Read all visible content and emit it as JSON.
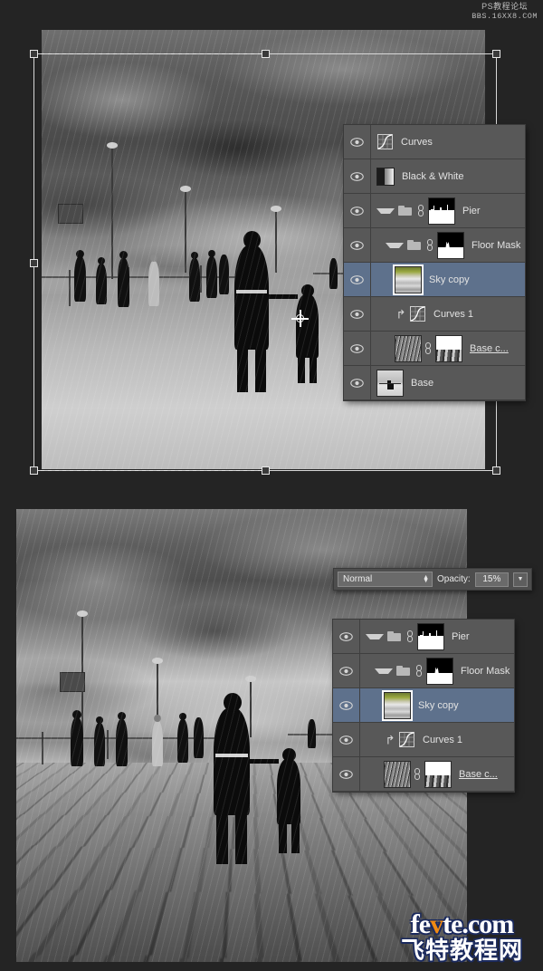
{
  "watermark_top": {
    "line1": "PS教程论坛",
    "line2": "BBS.16XX8.COM"
  },
  "logo": {
    "part1": "fe",
    "accent": "v",
    "part2": "te.com",
    "chinese": "飞特教程网",
    "accent_color": "#f08a12",
    "outline_color": "#1b2a5e"
  },
  "blend_bar": {
    "mode": "Normal",
    "opacity_label": "Opacity:",
    "opacity_value": "15%"
  },
  "layers_panel_top": {
    "rows": [
      {
        "name": "Curves",
        "icon": "curves-adjustment-icon",
        "visible": true,
        "selected": false,
        "indent": 0,
        "clipped": false,
        "group": false,
        "thumb": "none"
      },
      {
        "name": "Black & White",
        "icon": "black-white-adjustment-icon",
        "visible": true,
        "selected": false,
        "indent": 0,
        "clipped": false,
        "group": false,
        "thumb": "none"
      },
      {
        "name": "Pier",
        "icon": "folder-icon",
        "visible": true,
        "selected": false,
        "indent": 0,
        "clipped": false,
        "group": true,
        "thumb": "mask-pier"
      },
      {
        "name": "Floor Mask",
        "icon": "folder-icon",
        "visible": true,
        "selected": false,
        "indent": 1,
        "clipped": false,
        "group": true,
        "thumb": "mask-floor"
      },
      {
        "name": "Sky copy",
        "icon": "layer-thumbnail",
        "visible": true,
        "selected": true,
        "indent": 1,
        "clipped": false,
        "group": false,
        "thumb": "sky"
      },
      {
        "name": "Curves 1",
        "icon": "curves-adjustment-icon",
        "visible": true,
        "selected": false,
        "indent": 1,
        "clipped": true,
        "group": false,
        "thumb": "none"
      },
      {
        "name": "Base c...",
        "icon": "layer-thumbnail",
        "visible": true,
        "selected": false,
        "indent": 1,
        "clipped": false,
        "group": false,
        "thumb": "noise-mask",
        "underline": true
      },
      {
        "name": "Base",
        "icon": "layer-thumbnail",
        "visible": true,
        "selected": false,
        "indent": 0,
        "clipped": false,
        "group": false,
        "thumb": "base"
      }
    ]
  },
  "layers_panel_bottom": {
    "rows": [
      {
        "name": "Pier",
        "icon": "folder-icon",
        "visible": true,
        "selected": false,
        "indent": 0,
        "clipped": false,
        "group": true,
        "thumb": "mask-pier"
      },
      {
        "name": "Floor Mask",
        "icon": "folder-icon",
        "visible": true,
        "selected": false,
        "indent": 1,
        "clipped": false,
        "group": true,
        "thumb": "mask-floor"
      },
      {
        "name": "Sky copy",
        "icon": "layer-thumbnail",
        "visible": true,
        "selected": true,
        "indent": 1,
        "clipped": false,
        "group": false,
        "thumb": "sky"
      },
      {
        "name": "Curves 1",
        "icon": "curves-adjustment-icon",
        "visible": true,
        "selected": false,
        "indent": 1,
        "clipped": true,
        "group": false,
        "thumb": "none"
      },
      {
        "name": "Base c...",
        "icon": "layer-thumbnail",
        "visible": true,
        "selected": false,
        "indent": 1,
        "clipped": false,
        "group": false,
        "thumb": "noise-mask",
        "underline": true
      }
    ]
  },
  "canvas_top": {
    "tool_state": "free-transform-active",
    "reference_point": "center"
  },
  "colors": {
    "app_background": "#242424",
    "panel_background": "#535353",
    "row_background": "#585858",
    "row_selected": "#5e718c",
    "text": "#e2e2e2"
  }
}
